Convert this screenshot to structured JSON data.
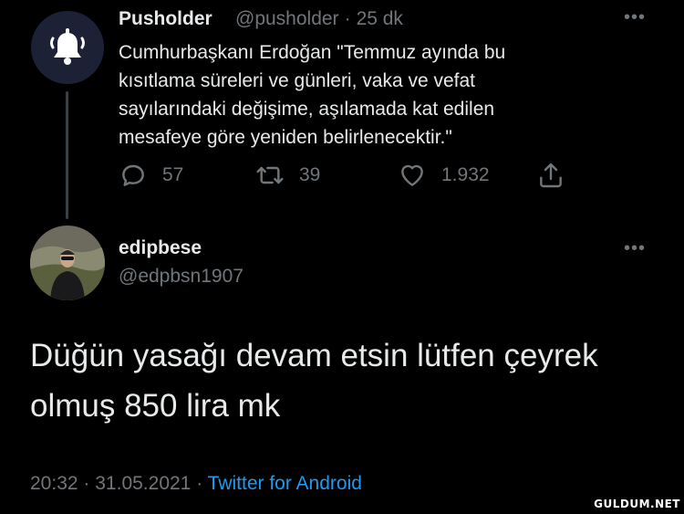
{
  "tweet1": {
    "display_name": "Pusholder",
    "handle": "@pusholder",
    "separator": "·",
    "time": "25 dk",
    "text_lines": [
      "Cumhurbaşkanı Erdoğan \"Temmuz ayında bu",
      "kısıtlama süreleri ve günleri, vaka ve vefat",
      "sayılarındaki değişime, aşılamada kat edilen",
      "mesafeye göre yeniden belirlenecektir.\""
    ],
    "replies": "57",
    "retweets": "39",
    "likes": "1.932",
    "avatar_icon": "bell-icon",
    "avatar_color": "#1c2136"
  },
  "tweet2": {
    "display_name": "edipbese",
    "handle": "@edpbsn1907",
    "text_lines": [
      "Düğün yasağı devam etsin lütfen çeyrek",
      "olmuş 850 lira mk"
    ],
    "time": "20:32",
    "date": "31.05.2021",
    "separator": "·",
    "source": "Twitter for Android"
  },
  "more_label": "•••",
  "watermark": "GULDUM.NET",
  "colors": {
    "background": "#000000",
    "text": "#e7e9ea",
    "muted": "#71767b",
    "link": "#1d9bf0"
  }
}
